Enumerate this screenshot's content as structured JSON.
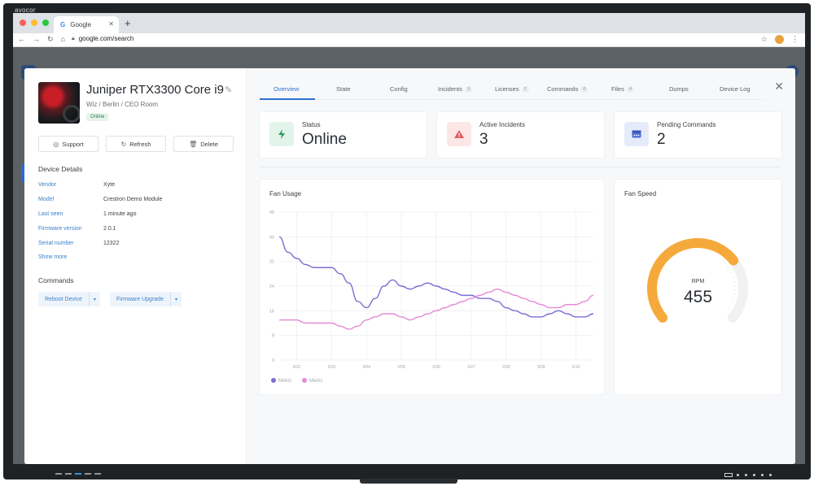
{
  "monitor": {
    "brand": "avocor"
  },
  "browser": {
    "tab_title": "Google",
    "tab_favicon": "G",
    "url": "google.com/search"
  },
  "device": {
    "name": "Juniper RTX3300 Core i9",
    "location": "Wiz / Berlin / CEO Room",
    "status_badge": "Online"
  },
  "actions": {
    "support": "Support",
    "refresh": "Refresh",
    "delete": "Delete"
  },
  "details": {
    "title": "Device Details",
    "rows": [
      {
        "key": "Vendor",
        "value": "Xyte"
      },
      {
        "key": "Model",
        "value": "Crestron Demo Module"
      },
      {
        "key": "Last seen",
        "value": "1 minute ago"
      },
      {
        "key": "Firmware version",
        "value": "2.0.1"
      },
      {
        "key": "Serial number",
        "value": "12322"
      }
    ],
    "show_more": "Show more"
  },
  "commands": {
    "title": "Commands",
    "reboot": "Reboot Device",
    "firmware": "Firmware Upgrade"
  },
  "tabs": [
    {
      "label": "Overview",
      "count": ""
    },
    {
      "label": "State",
      "count": ""
    },
    {
      "label": "Config",
      "count": ""
    },
    {
      "label": "Incidents",
      "count": "3"
    },
    {
      "label": "Licenses",
      "count": "2"
    },
    {
      "label": "Commands",
      "count": "0"
    },
    {
      "label": "Files",
      "count": "4"
    },
    {
      "label": "Dumps",
      "count": ""
    },
    {
      "label": "Device Log",
      "count": ""
    }
  ],
  "stats": [
    {
      "label": "Status",
      "value": "Online"
    },
    {
      "label": "Active Incidents",
      "value": "3"
    },
    {
      "label": "Pending Commands",
      "value": "2"
    }
  ],
  "fan_speed": {
    "title": "Fan Speed",
    "unit": "RPM",
    "value": "455",
    "fraction": 0.7
  },
  "colors": {
    "accent": "#2f6fd1",
    "series1": "#7b6fd4",
    "series2": "#e58bd6",
    "gauge": "#f6a93b",
    "success": "#2d9a5a",
    "danger": "#e05b5b"
  },
  "chart_data": {
    "type": "line",
    "title": "Fan Usage",
    "categories": [
      "X02",
      "X03",
      "X04",
      "X05",
      "X06",
      "X07",
      "X08",
      "X09",
      "X10"
    ],
    "x": [
      0,
      1,
      2,
      3,
      4,
      5,
      6,
      7,
      8,
      9,
      10,
      11,
      12,
      13,
      14,
      15,
      16,
      17,
      18,
      19,
      20,
      21,
      22,
      23,
      24,
      25,
      26,
      27,
      28,
      29,
      30,
      31,
      32,
      33,
      34,
      35,
      36
    ],
    "series": [
      {
        "name": "Metric",
        "values": [
          40,
          35,
          33,
          31,
          30,
          30,
          30,
          28,
          25,
          19,
          17,
          20,
          24,
          26,
          24,
          23,
          24,
          25,
          24,
          23,
          22,
          21,
          21,
          20,
          20,
          19,
          17,
          16,
          15,
          14,
          14,
          15,
          16,
          15,
          14,
          14,
          15
        ]
      },
      {
        "name": "Metric",
        "values": [
          13,
          13,
          13,
          12,
          12,
          12,
          12,
          11,
          10,
          11,
          13,
          14,
          15,
          15,
          14,
          13,
          14,
          15,
          16,
          17,
          18,
          19,
          20,
          21,
          22,
          23,
          22,
          21,
          20,
          19,
          18,
          17,
          17,
          18,
          18,
          19,
          21
        ]
      }
    ],
    "yticks": [
      0,
      8,
      16,
      24,
      32,
      40,
      48
    ],
    "ylim": [
      0,
      48
    ],
    "xlabel": "",
    "ylabel": "",
    "grid": true,
    "legend": "bottom-left"
  }
}
